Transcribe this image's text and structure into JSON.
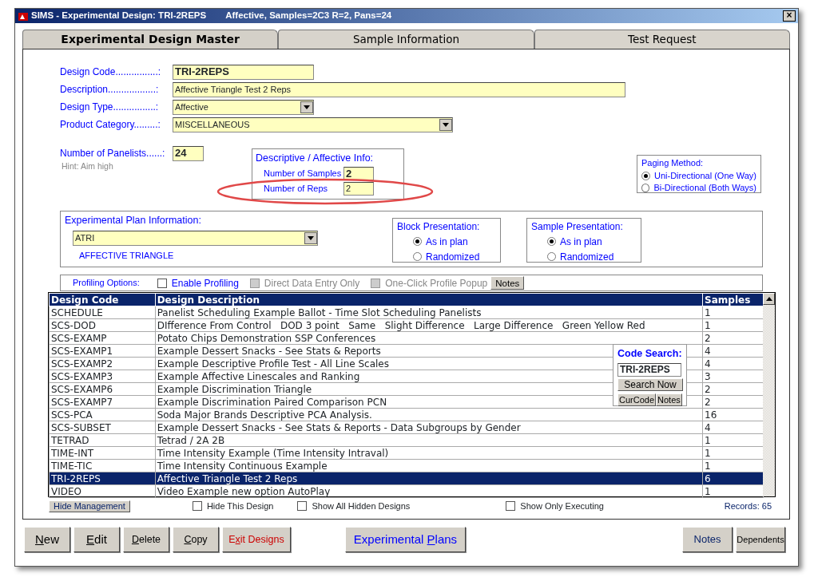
{
  "window": {
    "title": "SIMS - Experimental Design: TRI-2REPS",
    "subtitle": "Affective, Samples=2C3 R=2, Pans=24",
    "close": "×"
  },
  "tabs": [
    {
      "label": "Experimental Design Master",
      "selected": true
    },
    {
      "label": "Sample Information",
      "selected": false
    },
    {
      "label": "Test Request",
      "selected": false
    }
  ],
  "fields": [
    {
      "label": "Design Code................:",
      "value": "TRI-2REPS",
      "kind": "text",
      "emphasis": true
    },
    {
      "label": "Description..................:",
      "value": "Affective Triangle Test 2 Reps",
      "kind": "text",
      "emphasis": false
    },
    {
      "label": "Design Type................:",
      "value": "Affective",
      "kind": "select",
      "emphasis": false
    },
    {
      "label": "Product Category.........:",
      "value": "MISCELLANEOUS",
      "kind": "select",
      "emphasis": false
    }
  ],
  "panelists": {
    "label": "Number of Panelists......:",
    "value": "24",
    "hint": "Hint: Aim high"
  },
  "descriptive_info": {
    "title": "Descriptive / Affective Info:",
    "rows": [
      {
        "label": "Number of Samples",
        "value": "2",
        "emphasis": true,
        "circled": false
      },
      {
        "label": "Number of Reps",
        "value": "2",
        "emphasis": false,
        "circled": true
      }
    ]
  },
  "paging": {
    "title": "Paging Method:",
    "options": [
      {
        "label": "Uni-Directional (One Way)",
        "selected": true
      },
      {
        "label": "Bi-Directional (Both Ways)",
        "selected": false
      }
    ]
  },
  "plan": {
    "title": "Experimental Plan Information:",
    "value": "ATRI",
    "caption": "AFFECTIVE TRIANGLE"
  },
  "presentations": [
    {
      "title": "Block Presentation:",
      "options": [
        {
          "label": "As in plan",
          "selected": true
        },
        {
          "label": "Randomized",
          "selected": false
        }
      ]
    },
    {
      "title": "Sample Presentation:",
      "options": [
        {
          "label": "As in plan",
          "selected": true
        },
        {
          "label": "Randomized",
          "selected": false
        }
      ]
    }
  ],
  "profiling": {
    "label": "Profiling Options:",
    "options": [
      {
        "label": "Enable Profiling",
        "checked": false,
        "disabled": false
      },
      {
        "label": "Direct Data Entry Only",
        "checked": false,
        "disabled": true
      },
      {
        "label": "One-Click Profile Popup",
        "checked": false,
        "disabled": true
      }
    ],
    "notes": "Notes"
  },
  "table": {
    "columns": [
      "Design Code",
      "Design Description",
      "Samples"
    ],
    "rows": [
      {
        "cells": [
          "SCHEDULE",
          "Panelist Scheduling Example Ballot - Time Slot Scheduling Panelists",
          "1"
        ],
        "selected": false
      },
      {
        "cells": [
          "SCS-DOD",
          "DIfference From Control   DOD 3 point   Same   Slight Difference   Large Difference   Green Yellow Red",
          "1"
        ],
        "selected": false
      },
      {
        "cells": [
          "SCS-EXAMP",
          "Potato Chips Demonstration SSP Conferences",
          "2"
        ],
        "selected": false
      },
      {
        "cells": [
          "SCS-EXAMP1",
          "Example Dessert Snacks - See Stats & Reports",
          "4"
        ],
        "selected": false
      },
      {
        "cells": [
          "SCS-EXAMP2",
          "Example Descriptive Profile Test - All Line Scales",
          "4"
        ],
        "selected": false
      },
      {
        "cells": [
          "SCS-EXAMP3",
          "Example Affective Linescales and Ranking",
          "3"
        ],
        "selected": false
      },
      {
        "cells": [
          "SCS-EXAMP6",
          "Example Discrimination Triangle",
          "2"
        ],
        "selected": false
      },
      {
        "cells": [
          "SCS-EXAMP7",
          "Example Discrimination Paired Comparison PCN",
          "2"
        ],
        "selected": false
      },
      {
        "cells": [
          "SCS-PCA",
          "Soda Major Brands Descriptive PCA Analysis.",
          "16"
        ],
        "selected": false
      },
      {
        "cells": [
          "SCS-SUBSET",
          "Example Dessert Snacks - See Stats & Reports - Data Subgroups by Gender",
          "4"
        ],
        "selected": false
      },
      {
        "cells": [
          "TETRAD",
          "Tetrad / 2A 2B",
          "1"
        ],
        "selected": false
      },
      {
        "cells": [
          "TIME-INT",
          "Time Intensity Example (Time Intensity Intraval)",
          "1"
        ],
        "selected": false
      },
      {
        "cells": [
          "TIME-TIC",
          "Time Intensity Continuous Example",
          "1"
        ],
        "selected": false
      },
      {
        "cells": [
          "TRI-2REPS",
          "Affective Triangle Test 2 Reps",
          "6"
        ],
        "selected": true
      },
      {
        "cells": [
          "VIDEO",
          "Video Example new option AutoPlay",
          "1"
        ],
        "selected": false
      }
    ]
  },
  "code_search": {
    "title": "Code Search:",
    "value": "TRI-2REPS",
    "search": "Search Now",
    "buttons": [
      "CurCode",
      "Notes"
    ]
  },
  "footer": {
    "hide_button": "Hide Management",
    "checks": [
      {
        "label": "Hide This Design",
        "checked": false
      },
      {
        "label": "Show All Hidden Designs",
        "checked": false
      },
      {
        "label": "Show Only Executing",
        "checked": false
      }
    ],
    "records": "Records: 65"
  },
  "buttons": [
    {
      "key": "N",
      "after": "ew",
      "kind": "large"
    },
    {
      "key": "E",
      "after": "dit",
      "kind": "large"
    },
    {
      "key": "D",
      "after": "elete",
      "kind": "normal"
    },
    {
      "key": "C",
      "after": "opy",
      "kind": "normal"
    },
    {
      "before": "E",
      "key": "x",
      "after": "it Designs",
      "kind": "exit"
    },
    {
      "before": "Experimental ",
      "key": "P",
      "after": "lans",
      "kind": "link"
    },
    {
      "label": "Notes",
      "kind": "notes"
    },
    {
      "label": "Dependents",
      "kind": "small"
    }
  ]
}
